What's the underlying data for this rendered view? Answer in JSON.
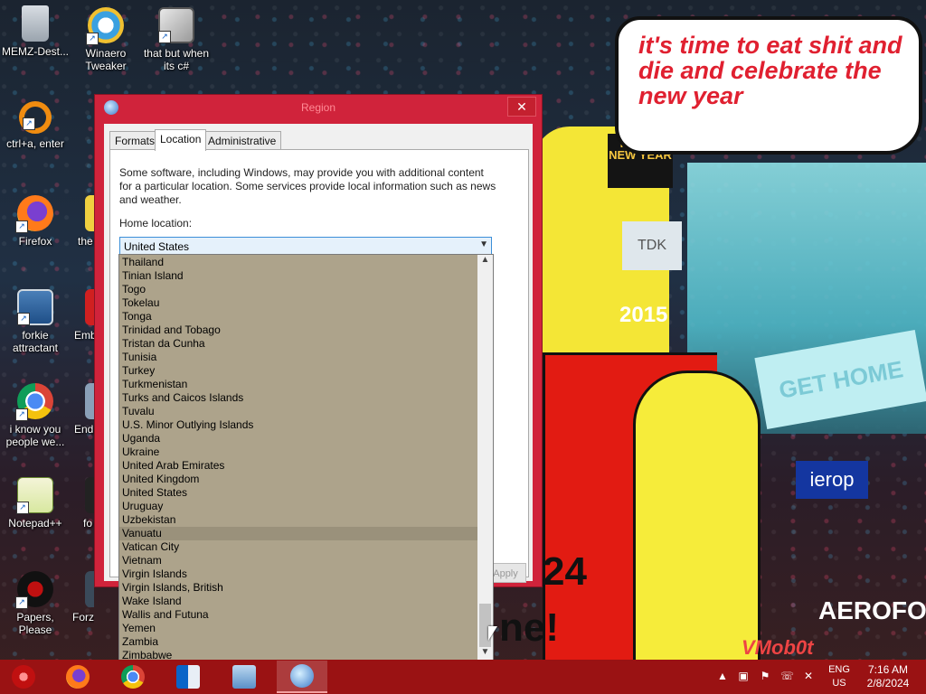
{
  "wallpaper": {
    "bubble_text": "it's time to eat shit and die and celebrate the new year",
    "sign_happy": "HAPPY NEW YEAR",
    "sign_tdk": "TDK",
    "sign_2015": "2015",
    "sign_gethome": "GET HOME",
    "sign_ierop": "ierop",
    "sign_aero": "AEROFOS",
    "big_text_1": "24",
    "big_text_2": "ne!",
    "vm_tag": "VMob0t"
  },
  "desktop_icons": [
    {
      "label": "MEMZ-Dest...",
      "icon": "recycle-bin-icon"
    },
    {
      "label": "Winaero Tweaker",
      "icon": "winaero-icon"
    },
    {
      "label": "that but when its c#",
      "icon": "stack-icon"
    },
    {
      "label": "ctrl+a, enter",
      "icon": "ring-icon"
    },
    {
      "label": "Firefox",
      "icon": "firefox-icon"
    },
    {
      "label": "the",
      "icon": "app-icon"
    },
    {
      "label": "forkie attractant",
      "icon": "settings-monitor-icon"
    },
    {
      "label": "Emb De",
      "icon": "app-icon"
    },
    {
      "label": "i know you people we...",
      "icon": "chrome-icon"
    },
    {
      "label": "Endi",
      "icon": "app-icon"
    },
    {
      "label": "Notepad++",
      "icon": "notepadpp-icon"
    },
    {
      "label": "fo som",
      "icon": "app-icon"
    },
    {
      "label": "Papers, Please",
      "icon": "papers-please-icon"
    },
    {
      "label": "Forza Hor Sixe",
      "icon": "forza-icon"
    }
  ],
  "dialog": {
    "title": "Region",
    "close_glyph": "✕",
    "tabs": [
      "Formats",
      "Location",
      "Administrative"
    ],
    "active_tab": "Location",
    "description": "Some software, including Windows, may provide you with additional content for a particular location. Some services provide local information such as news and weather.",
    "home_location_label": "Home location:",
    "home_location_value": "United States",
    "apply_label": "Apply"
  },
  "dropdown": {
    "items": [
      "Thailand",
      "Tinian Island",
      "Togo",
      "Tokelau",
      "Tonga",
      "Trinidad and Tobago",
      "Tristan da Cunha",
      "Tunisia",
      "Turkey",
      "Turkmenistan",
      "Turks and Caicos Islands",
      "Tuvalu",
      "U.S. Minor Outlying Islands",
      "Uganda",
      "Ukraine",
      "United Arab Emirates",
      "United Kingdom",
      "United States",
      "Uruguay",
      "Uzbekistan",
      "Vanuatu",
      "Vatican City",
      "Vietnam",
      "Virgin Islands",
      "Virgin Islands, British",
      "Wake Island",
      "Wallis and Futuna",
      "Yemen",
      "Zambia",
      "Zimbabwe"
    ],
    "highlighted": "Vanuatu",
    "scroll_position": 0.94
  },
  "taskbar": {
    "apps": [
      "firefox-icon",
      "chrome-icon",
      "outlook-icon",
      "control-panel-icon",
      "region-icon"
    ],
    "active_app": "region-icon",
    "language": "ENG",
    "region": "US",
    "time": "7:16 AM",
    "date": "2/8/2024"
  },
  "colors": {
    "dialog_frame": "#d0233b",
    "taskbar": "#9a1213",
    "dropdown_bg": "#ada38b"
  }
}
